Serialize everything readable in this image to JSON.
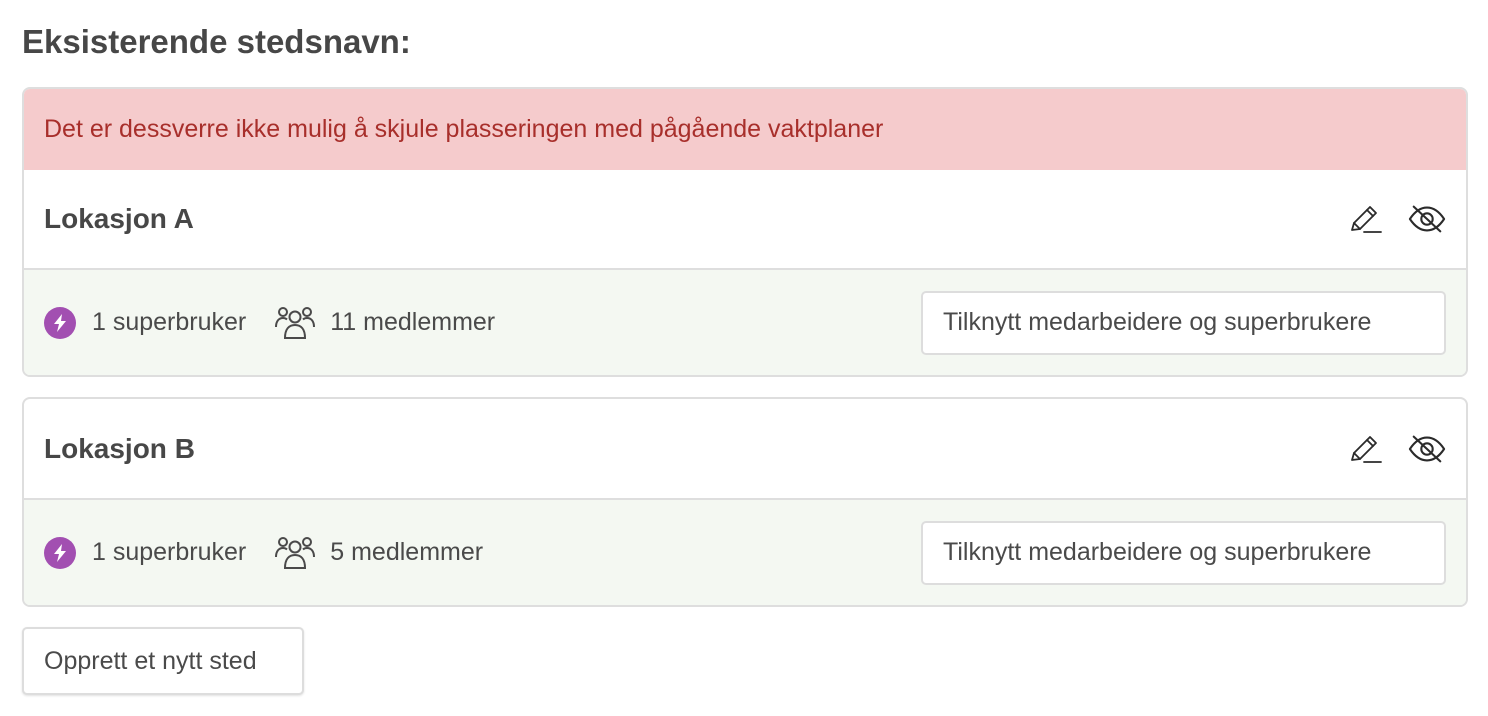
{
  "page": {
    "title": "Eksisterende stedsnavn:"
  },
  "alert": {
    "message": "Det er dessverre ikke mulig å skjule plasseringen med pågående vaktplaner"
  },
  "locations": [
    {
      "name": "Lokasjon A",
      "superusers_label": "1 superbruker",
      "members_label": "11 medlemmer",
      "assign_button_label": "Tilknytt medarbeidere og superbrukere"
    },
    {
      "name": "Lokasjon B",
      "superusers_label": "1 superbruker",
      "members_label": "5 medlemmer",
      "assign_button_label": "Tilknytt medarbeidere og superbrukere"
    }
  ],
  "icons": {
    "edit": "pencil-icon",
    "hide": "eye-off-icon",
    "superuser": "lightning-bolt-icon",
    "members": "people-group-icon"
  },
  "actions": {
    "create_label": "Opprett et nytt sted"
  },
  "colors": {
    "alert_bg": "#f5cbcc",
    "alert_text": "#a82f2b",
    "footer_bg": "#f4f8f2",
    "superuser_badge": "#a24fb1",
    "border": "#dedede"
  }
}
